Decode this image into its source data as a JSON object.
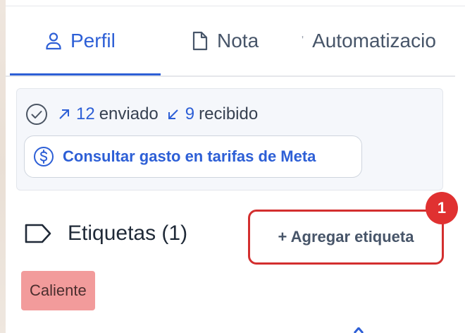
{
  "tabs": [
    {
      "label": "Perfil",
      "icon": "user-icon",
      "active": true
    },
    {
      "label": "Nota",
      "icon": "document-icon",
      "active": false
    },
    {
      "label": "Automatizacio",
      "icon": "bolt-icon",
      "active": false
    }
  ],
  "messages": {
    "status_icon": "check-circle-icon",
    "sent_count": "12",
    "sent_label": "enviado",
    "received_count": "9",
    "received_label": "recibido"
  },
  "meta_button": {
    "label": "Consultar gasto en tarifas de Meta",
    "icon": "dollar-circle-icon"
  },
  "tags": {
    "title": "Etiquetas (1)",
    "icon": "tag-icon",
    "add_label": "+ Agregar etiqueta",
    "badge": "1",
    "items": [
      "Caliente"
    ]
  },
  "colors": {
    "accent": "#2d5fd6",
    "highlight_border": "#d32f2f",
    "badge": "#e03131",
    "tag_hot": "#f29b9b"
  }
}
